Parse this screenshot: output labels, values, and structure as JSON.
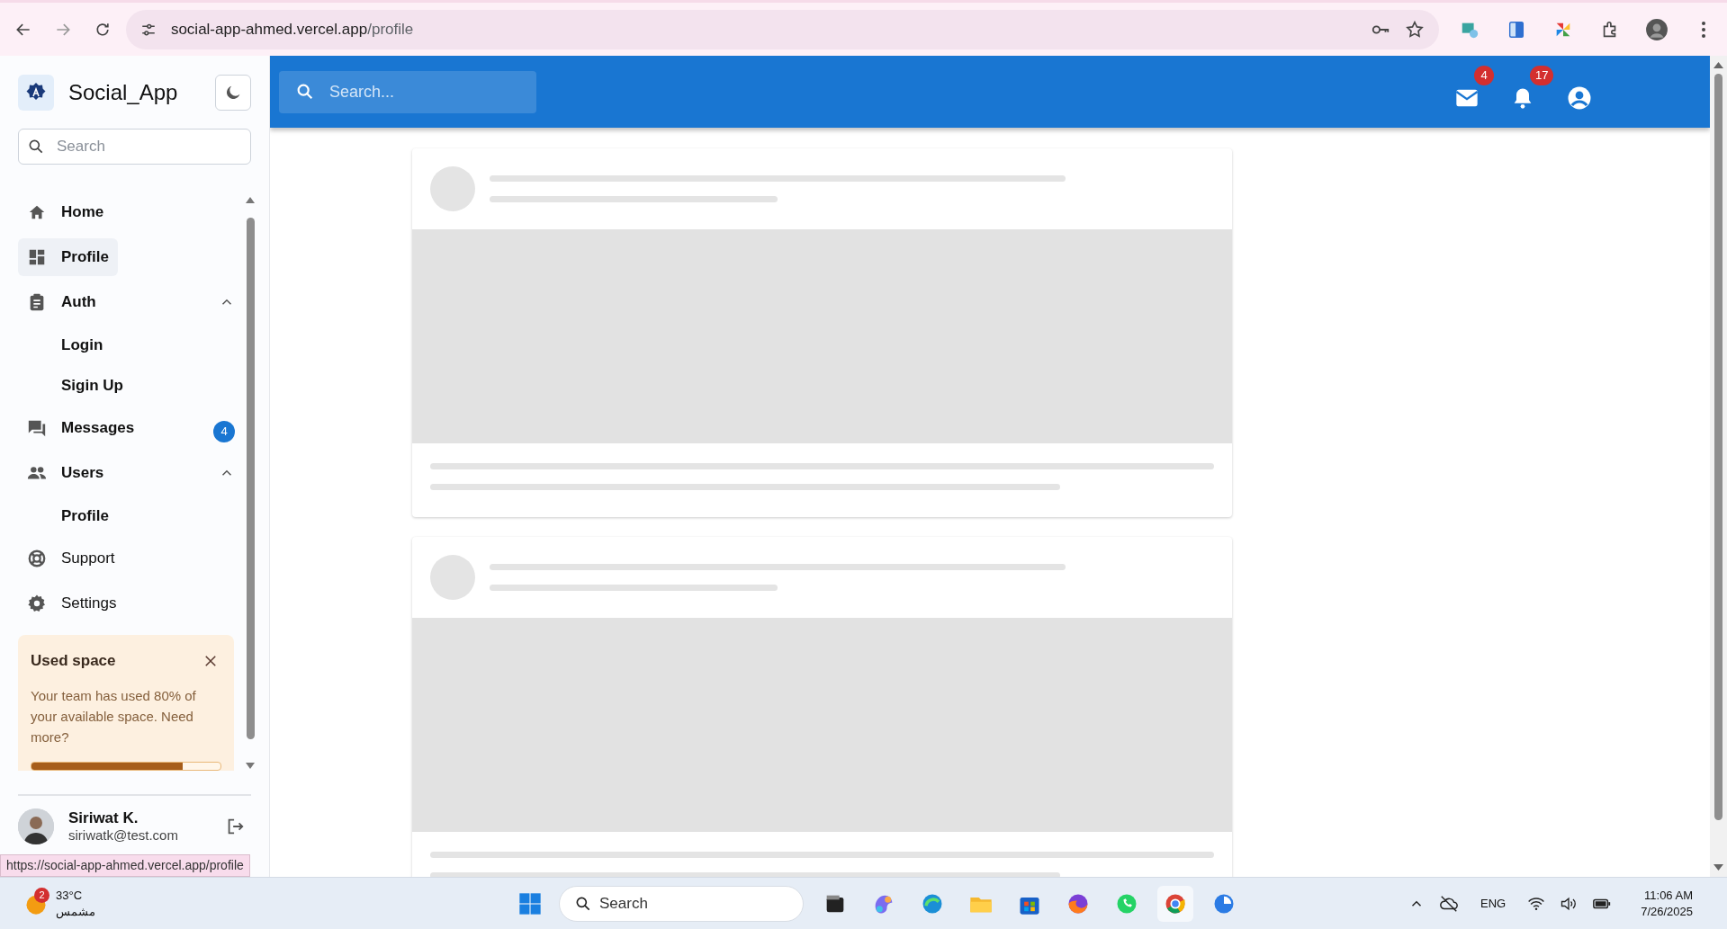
{
  "browser": {
    "url_host": "social-app-ahmed.vercel.app",
    "url_path": "/profile",
    "status_url": "https://social-app-ahmed.vercel.app/profile"
  },
  "sidebar": {
    "app_name": "Social_App",
    "search": {
      "placeholder": "Search"
    },
    "items": [
      {
        "label": "Home",
        "selected": false
      },
      {
        "label": "Profile",
        "selected": true
      },
      {
        "label": "Auth",
        "selected": false,
        "expanded": true,
        "children": [
          {
            "label": "Login",
            "selected": false
          },
          {
            "label": "Sigin Up",
            "selected": false
          }
        ]
      },
      {
        "label": "Messages",
        "selected": false,
        "badge": "4"
      },
      {
        "label": "Users",
        "selected": false,
        "expanded": true,
        "children": [
          {
            "label": "Profile",
            "selected": false
          }
        ]
      },
      {
        "label": "Support",
        "selected": false
      },
      {
        "label": "Settings",
        "selected": false
      }
    ],
    "notice": {
      "title": "Used space",
      "text": "Your team has used 80% of your available space. Need more?",
      "level": 0.8
    },
    "user": {
      "name": "Siriwat K.",
      "email": "siriwatk@test.com"
    }
  },
  "header": {
    "search": {
      "placeholder": "Search..."
    },
    "mail_count": "4",
    "notification_count": "17"
  },
  "feed": [
    {
      "kind": "skeleton"
    },
    {
      "kind": "skeleton"
    }
  ],
  "taskbar": {
    "weather_badge": "2",
    "temperature": "33°C",
    "condition": "مشمس",
    "search": "Search",
    "language": "ENG",
    "time": "11:06 AM",
    "date": "7/26/2025"
  }
}
